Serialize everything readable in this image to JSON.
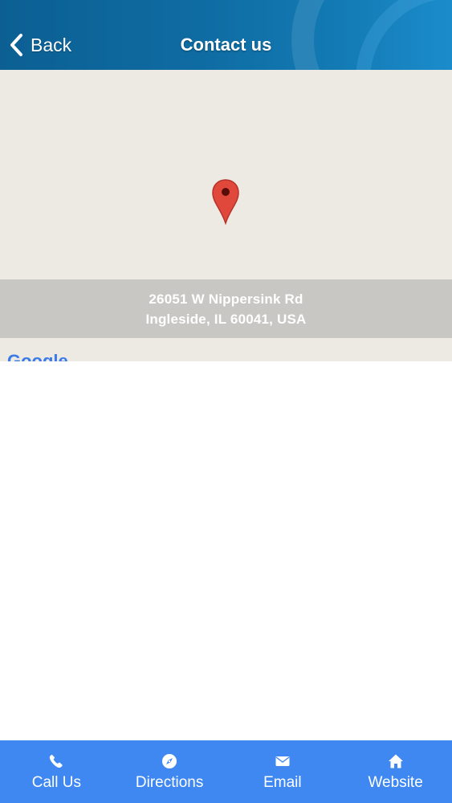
{
  "header": {
    "back_label": "Back",
    "title": "Contact us"
  },
  "map": {
    "address_line1": "26051 W Nippersink Rd",
    "address_line2": "Ingleside, IL 60041, USA",
    "provider_logo": "Google",
    "pin_color": "#e0483b"
  },
  "tabbar": {
    "color": "#3f88f2",
    "items": [
      {
        "label": "Call Us",
        "icon": "phone-icon"
      },
      {
        "label": "Directions",
        "icon": "compass-icon"
      },
      {
        "label": "Email",
        "icon": "envelope-icon"
      },
      {
        "label": "Website",
        "icon": "home-icon"
      }
    ]
  }
}
